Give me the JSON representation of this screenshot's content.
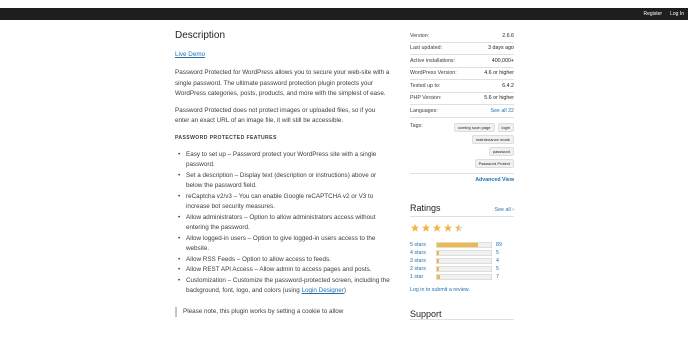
{
  "topbar": {
    "register": "Register",
    "login": "Log In"
  },
  "main": {
    "title": "Description",
    "demo_link": "Live Demo",
    "para1": "Password Protected for WordPress allows you to secure your web-site with a single password. The ultimate password protection plugin protects your WordPress categories, posts, products, and more with the simplest of ease.",
    "para2": "Password Protected does not protect images or uploaded files, so if you enter an exact URL of an image file, it will still be accessible.",
    "features_head": "PASSWORD PROTECTED FEATURES",
    "features": [
      "Easy to set up – Password protect your WordPress site with a single password.",
      "Set a description – Display text (description or instructions) above or below the password field.",
      "reCaptcha v2/v3 – You can enable Google reCAPTCHA v2 or V3 to increase bot security measures.",
      "Allow administrators – Option to allow administrators access without entering the password.",
      "Allow logged-in users – Option to give logged-in users access to the website.",
      "Allow RSS Feeds – Option to allow access to feeds.",
      "Allow REST API Access – Allow admin to access pages and posts."
    ],
    "customization_text": "Customization – Customize the password-protected screen, including the background, font, logo, and colors (using ",
    "customization_link": "Login Designer",
    "customization_end": ")",
    "note": "Please note, this plugin works by setting a cookie to allow"
  },
  "meta": {
    "version_label": "Version:",
    "version": "2.6.6",
    "updated_label": "Last updated:",
    "updated": "3 days ago",
    "installs_label": "Active installations:",
    "installs": "400,000+",
    "wp_label": "WordPress Version:",
    "wp": "4.6 or higher",
    "tested_label": "Tested up to:",
    "tested": "6.4.2",
    "php_label": "PHP Version:",
    "php": "5.6 or higher",
    "languages_label": "Languages:",
    "languages": "See all 22",
    "tags_label": "Tags:",
    "tags": [
      "coming soon page",
      "login",
      "maintenance mode",
      "password",
      "Password Protect"
    ],
    "advanced": "Advanced View"
  },
  "ratings": {
    "title": "Ratings",
    "see_all": "See all",
    "stars_value": 4.5,
    "rows": [
      {
        "label": "5 stars",
        "count": "89",
        "fraction": 0.76
      },
      {
        "label": "4 stars",
        "count": "5",
        "fraction": 0.04
      },
      {
        "label": "3 stars",
        "count": "4",
        "fraction": 0.035
      },
      {
        "label": "2 stars",
        "count": "5",
        "fraction": 0.04
      },
      {
        "label": "1 star",
        "count": "7",
        "fraction": 0.06
      }
    ],
    "submit": "Log in to submit a review."
  },
  "support": {
    "title": "Support"
  },
  "colors": {
    "accent": "#2271b1",
    "star": "#f0b849",
    "topbar": "#1e1e1e"
  }
}
